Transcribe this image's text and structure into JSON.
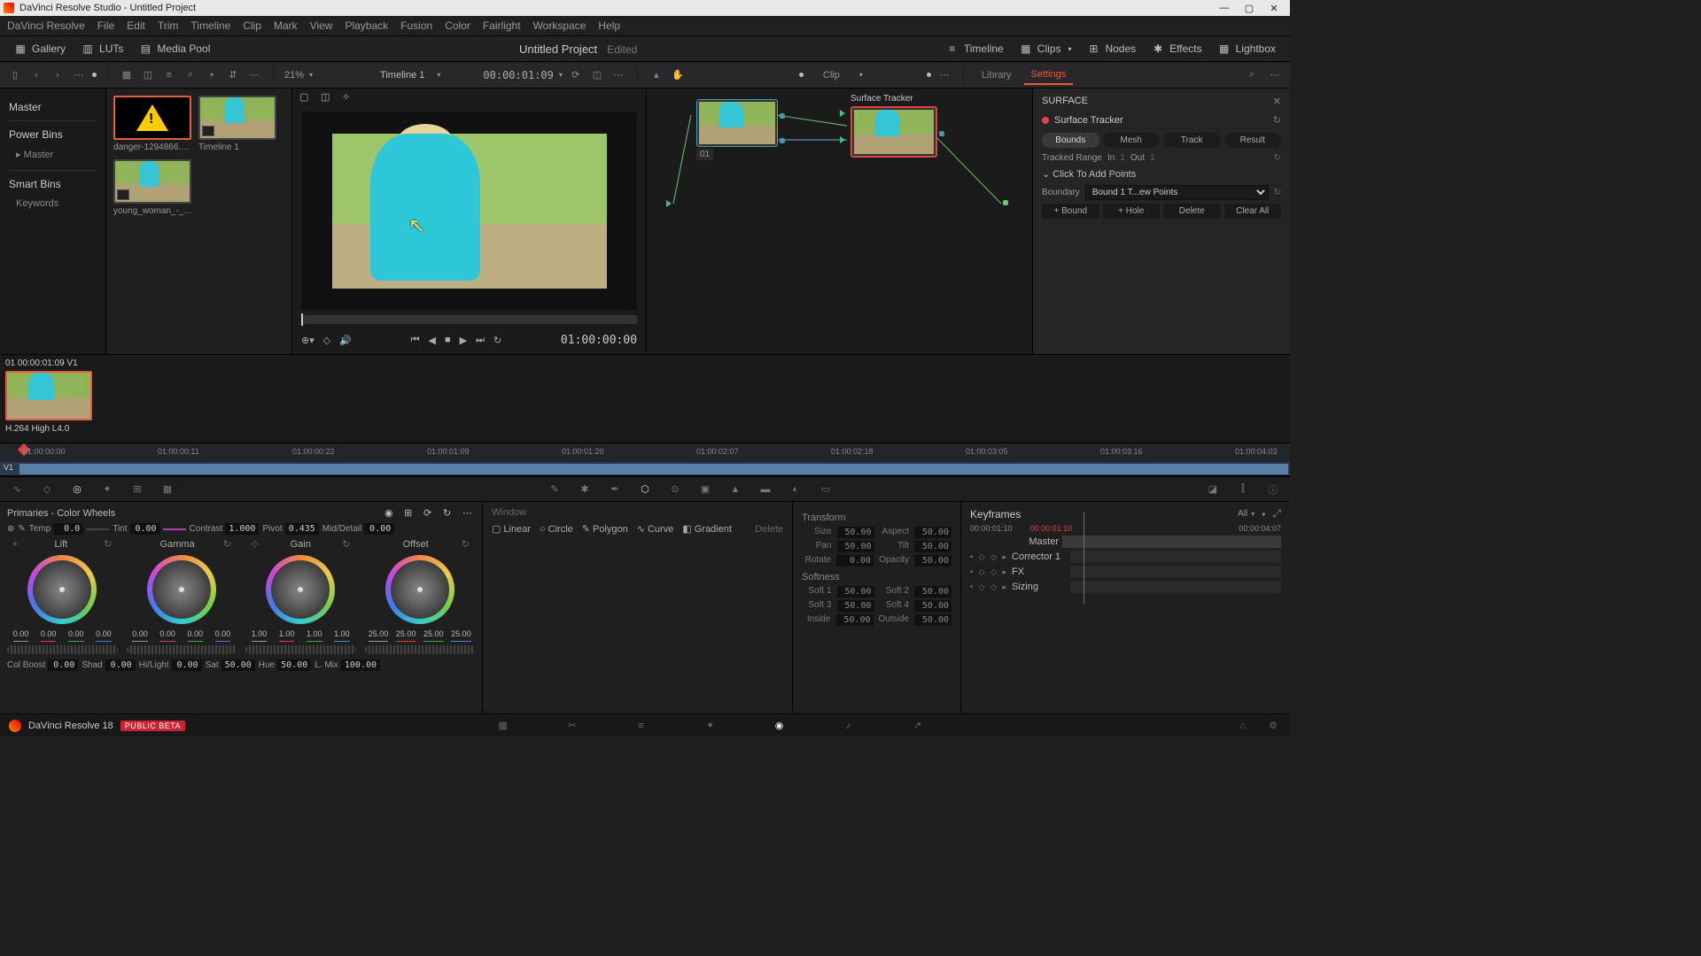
{
  "titlebar": {
    "title": "DaVinci Resolve Studio - Untitled Project"
  },
  "menubar": [
    "DaVinci Resolve",
    "File",
    "Edit",
    "Trim",
    "Timeline",
    "Clip",
    "Mark",
    "View",
    "Playback",
    "Fusion",
    "Color",
    "Fairlight",
    "Workspace",
    "Help"
  ],
  "toolbar1": {
    "gallery": "Gallery",
    "luts": "LUTs",
    "media_pool": "Media Pool",
    "project_title": "Untitled Project",
    "project_status": "Edited",
    "timeline": "Timeline",
    "clips": "Clips",
    "nodes": "Nodes",
    "effects": "Effects",
    "lightbox": "Lightbox"
  },
  "toolbar2": {
    "zoom": "21%",
    "timeline_name": "Timeline 1",
    "timecode": "00:00:01:09",
    "clip_label": "Clip",
    "library_tab": "Library",
    "settings_tab": "Settings"
  },
  "sidebar": {
    "master": "Master",
    "power_bins": "Power Bins",
    "power_master": "Master",
    "smart_bins": "Smart Bins",
    "keywords": "Keywords"
  },
  "media_pool": {
    "thumbs": [
      {
        "name": "danger-1294866.p..."
      },
      {
        "name": "Timeline 1"
      },
      {
        "name": "young_woman_-_..."
      }
    ]
  },
  "viewer": {
    "timecode": "01:00:00:00"
  },
  "nodes": {
    "surface_tracker": "Surface Tracker",
    "node1_num": "01"
  },
  "inspector": {
    "header": "SURFACE",
    "node_name": "Surface Tracker",
    "tabs": {
      "bounds": "Bounds",
      "mesh": "Mesh",
      "track": "Track",
      "result": "Result"
    },
    "tracked_range": "Tracked Range",
    "in": "In",
    "in_v": "1",
    "out": "Out",
    "out_v": "1",
    "click_to_add": "Click To Add Points",
    "boundary": "Boundary",
    "boundary_sel": "Bound 1 T...ew Points",
    "btns": {
      "bound": "+ Bound",
      "hole": "+ Hole",
      "delete": "Delete",
      "clear": "Clear All"
    }
  },
  "clip_strip": {
    "hdr": "01   00:00:01:09    V1",
    "format": "H.264 High L4.0"
  },
  "ruler": [
    "01:00:00:00",
    "01:00:00:11",
    "01:00:00:22",
    "01:00:01:09",
    "01:00:01:20",
    "01:00:02:07",
    "01:00:02:18",
    "01:00:03:05",
    "01:00:03:16",
    "01:00:04:03"
  ],
  "track_label": "V1",
  "primaries": {
    "title": "Primaries - Color Wheels",
    "params": {
      "temp": "Temp",
      "temp_v": "0.0",
      "tint": "Tint",
      "tint_v": "0.00",
      "contrast": "Contrast",
      "contrast_v": "1.000",
      "pivot": "Pivot",
      "pivot_v": "0.435",
      "middetail": "Mid/Detail",
      "middetail_v": "0.00"
    },
    "wheels": {
      "lift": {
        "label": "Lift",
        "vals": [
          "0.00",
          "0.00",
          "0.00",
          "0.00"
        ]
      },
      "gamma": {
        "label": "Gamma",
        "vals": [
          "0.00",
          "0.00",
          "0.00",
          "0.00"
        ]
      },
      "gain": {
        "label": "Gain",
        "vals": [
          "1.00",
          "1.00",
          "1.00",
          "1.00"
        ]
      },
      "offset": {
        "label": "Offset",
        "vals": [
          "25.00",
          "25.00",
          "25.00",
          "25.00"
        ]
      }
    },
    "bottom": {
      "colboost": "Col Boost",
      "colboost_v": "0.00",
      "shad": "Shad",
      "shad_v": "0.00",
      "hilight": "Hi/Light",
      "hilight_v": "0.00",
      "sat": "Sat",
      "sat_v": "50.00",
      "hue": "Hue",
      "hue_v": "50.00",
      "lmix": "L. Mix",
      "lmix_v": "100.00"
    }
  },
  "window_panel": {
    "title": "Window",
    "linear": "Linear",
    "circle": "Circle",
    "polygon": "Polygon",
    "curve": "Curve",
    "gradient": "Gradient",
    "delete": "Delete"
  },
  "transform": {
    "title": "Transform",
    "size": "Size",
    "size_v": "50.00",
    "aspect": "Aspect",
    "aspect_v": "50.00",
    "pan": "Pan",
    "pan_v": "50.00",
    "tilt": "Tilt",
    "tilt_v": "50.00",
    "rotate": "Rotate",
    "rotate_v": "0.00",
    "opacity": "Opacity",
    "opacity_v": "50.00",
    "softness": "Softness",
    "soft1": "Soft 1",
    "soft1_v": "50.00",
    "soft2": "Soft 2",
    "soft2_v": "50.00",
    "soft3": "Soft 3",
    "soft3_v": "50.00",
    "soft4": "Soft 4",
    "soft4_v": "50.00",
    "inside": "Inside",
    "inside_v": "50.00",
    "outside": "Outside",
    "outside_v": "50.00"
  },
  "keyframes": {
    "title": "Keyframes",
    "all": "All",
    "tc_start": "00:00:01:10",
    "tc_mid": "00:00:01:10",
    "tc_end": "00:00:04:07",
    "rows": [
      "Master",
      "Corrector 1",
      "FX",
      "Sizing"
    ]
  },
  "pagebar": {
    "app": "DaVinci Resolve 18",
    "beta": "PUBLIC BETA"
  }
}
